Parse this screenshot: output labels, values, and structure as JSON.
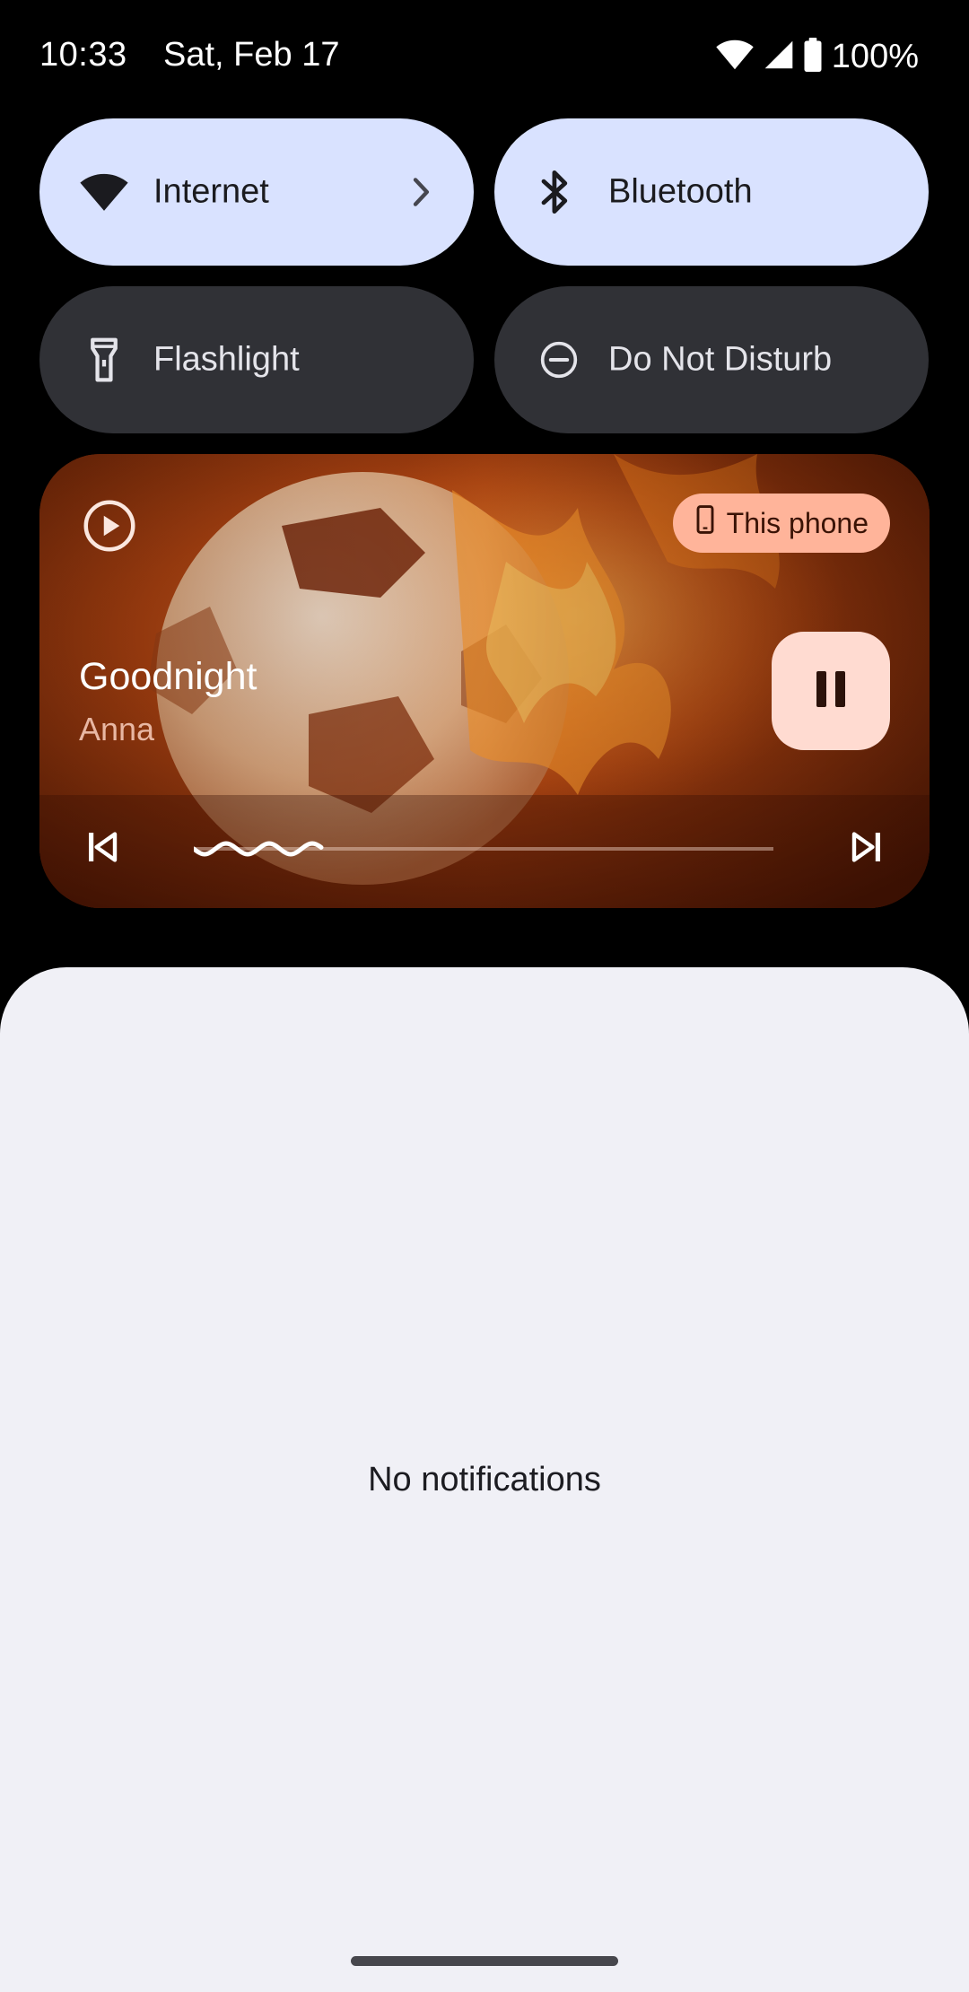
{
  "status_bar": {
    "time": "10:33",
    "date": "Sat, Feb 17",
    "battery_text": "100%",
    "icons": [
      "wifi-icon",
      "cell-signal-icon",
      "battery-icon"
    ]
  },
  "quick_settings": {
    "tiles": [
      {
        "label": "Internet",
        "icon": "wifi-icon",
        "state": "on",
        "has_chevron": true
      },
      {
        "label": "Bluetooth",
        "icon": "bluetooth-icon",
        "state": "on"
      },
      {
        "label": "Flashlight",
        "icon": "flashlight-icon",
        "state": "off"
      },
      {
        "label": "Do Not Disturb",
        "icon": "do-not-disturb-icon",
        "state": "off"
      }
    ]
  },
  "media": {
    "title": "Goodnight",
    "artist": "Anna",
    "output_device": "This phone",
    "state": "playing",
    "progress": 0.22,
    "accent_color": "#ffdbd1",
    "chip_color": "#ffb49a"
  },
  "notifications": {
    "empty_text": "No notifications"
  },
  "colors": {
    "tile_on": "#d9e2ff",
    "tile_off": "#303136",
    "panel_bg": "#f0f0f6"
  }
}
